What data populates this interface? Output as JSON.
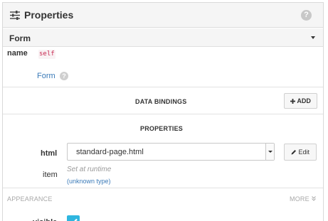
{
  "header": {
    "title": "Properties",
    "help": "?"
  },
  "type_selector": {
    "value": "Form"
  },
  "name_field": {
    "label": "name",
    "value": "self"
  },
  "type_link": {
    "label": "Form",
    "help": "?"
  },
  "data_bindings": {
    "title": "DATA BINDINGS",
    "add_label": "ADD"
  },
  "properties": {
    "title": "PROPERTIES",
    "html": {
      "label": "html",
      "value": "standard-page.html",
      "edit_label": "Edit"
    },
    "item": {
      "label": "item",
      "placeholder": "Set at runtime",
      "type_hint": "(unknown type)"
    }
  },
  "appearance": {
    "title": "APPEARANCE",
    "more_label": "MORE"
  },
  "visible": {
    "label": "visible",
    "checked": true
  },
  "colors": {
    "accent": "#2fb6df",
    "link": "#3a7ab8",
    "code": "#c7254e"
  }
}
